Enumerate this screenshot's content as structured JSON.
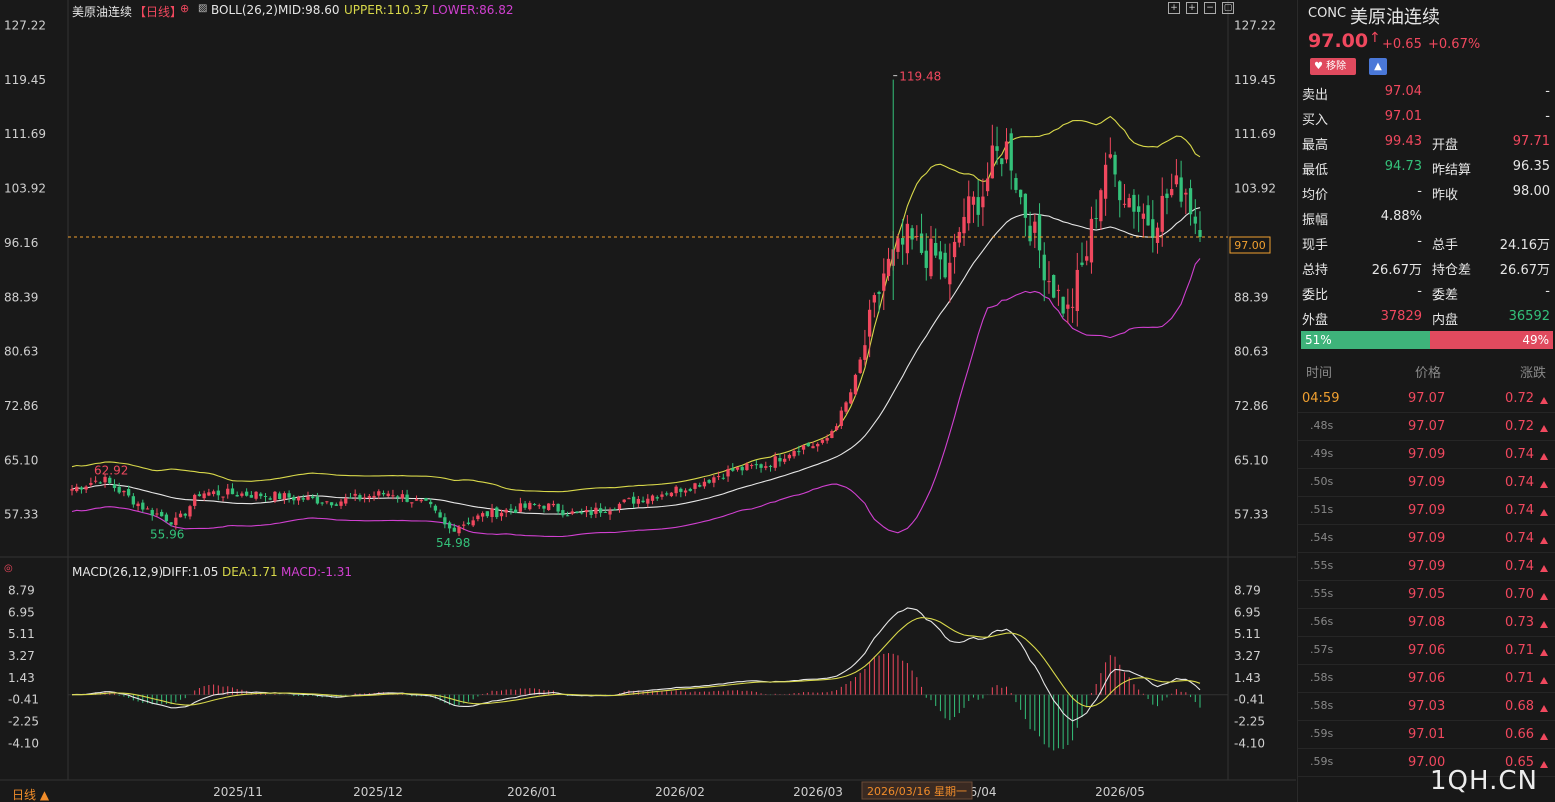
{
  "header": {
    "symbol_name": "美原油连续",
    "period": "【日线】",
    "boll_label": "BOLL(26,2)",
    "mid": "MID:98.60",
    "upper": "UPPER:110.37",
    "lower": "LOWER:86.82",
    "macd_label": "MACD(26,12,9)",
    "diff": "DIFF:1.05",
    "dea": "DEA:1.71",
    "macd": "MACD:-1.31"
  },
  "price_axis": [
    "127.22",
    "119.45",
    "111.69",
    "103.92",
    "96.16",
    "88.39",
    "80.63",
    "72.86",
    "65.10",
    "57.33"
  ],
  "macd_axis": [
    "8.79",
    "6.95",
    "5.11",
    "3.27",
    "1.43",
    "-0.41",
    "-2.25",
    "-4.10"
  ],
  "date_axis": [
    "2025/11",
    "2025/12",
    "2026/01",
    "2026/02",
    "2026/03",
    "6/04",
    "2026/05"
  ],
  "crosshair_date": "2026/03/16 星期一",
  "current_price_label": "97.00",
  "annotations": {
    "high": "119.48",
    "left_high": "62.92",
    "low1": "55.96",
    "low2": "54.98"
  },
  "bottom_period": "日线 ▲",
  "watermark": "1QH.CN",
  "colors": {
    "up": "#f0485e",
    "down": "#34c17a",
    "boll_upper": "#d8d84a",
    "boll_mid": "#e6e6e6",
    "boll_lower": "#d040d0",
    "dea": "#d8d84a"
  },
  "chart_data": {
    "type": "candlestick",
    "title": "美原油连续",
    "ylim": [
      53,
      128
    ],
    "key_values": {
      "high": 119.48,
      "low": 54.98,
      "last": 97.0
    },
    "boll": {
      "mid": 98.6,
      "upper": 110.37,
      "lower": 86.82
    },
    "macd": {
      "diff": 1.05,
      "dea": 1.71,
      "macd": -1.31,
      "ylim": [
        -5.5,
        9.5
      ]
    }
  },
  "quote": {
    "code": "CONC",
    "name": "美原油连续",
    "price": "97.00",
    "change": "+0.65",
    "change_pct": "+0.67%",
    "remove_btn": "移除",
    "rows": [
      {
        "l1": "卖出",
        "v1": "97.04",
        "c1": "red",
        "l2": "",
        "v2": "-",
        "c2": "white"
      },
      {
        "l1": "买入",
        "v1": "97.01",
        "c1": "red",
        "l2": "",
        "v2": "-",
        "c2": "white"
      },
      {
        "l1": "最高",
        "v1": "99.43",
        "c1": "red",
        "l2": "开盘",
        "v2": "97.71",
        "c2": "red"
      },
      {
        "l1": "最低",
        "v1": "94.73",
        "c1": "green",
        "l2": "昨结算",
        "v2": "96.35",
        "c2": "white"
      },
      {
        "l1": "均价",
        "v1": "-",
        "c1": "white",
        "l2": "昨收",
        "v2": "98.00",
        "c2": "white"
      },
      {
        "l1": "振幅",
        "v1": "4.88%",
        "c1": "white",
        "l2": "",
        "v2": "",
        "c2": "white"
      },
      {
        "l1": "现手",
        "v1": "-",
        "c1": "white",
        "l2": "总手",
        "v2": "24.16万",
        "c2": "white"
      },
      {
        "l1": "总持",
        "v1": "26.67万",
        "c1": "white",
        "l2": "持仓差",
        "v2": "26.67万",
        "c2": "white"
      },
      {
        "l1": "委比",
        "v1": "-",
        "c1": "white",
        "l2": "委差",
        "v2": "-",
        "c2": "white"
      },
      {
        "l1": "外盘",
        "v1": "37829",
        "c1": "red",
        "l2": "内盘",
        "v2": "36592",
        "c2": "green"
      }
    ],
    "ratio_left": "51%",
    "ratio_right": "49%",
    "ratio_value": 0.51,
    "tick_headers": {
      "time": "时间",
      "price": "价格",
      "change": "涨跌"
    },
    "ticks": [
      {
        "t": "04:59",
        "p": "97.07",
        "c": "0.72"
      },
      {
        "t": ".48s",
        "p": "97.07",
        "c": "0.72"
      },
      {
        "t": ".49s",
        "p": "97.09",
        "c": "0.74"
      },
      {
        "t": ".50s",
        "p": "97.09",
        "c": "0.74"
      },
      {
        "t": ".51s",
        "p": "97.09",
        "c": "0.74"
      },
      {
        "t": ".54s",
        "p": "97.09",
        "c": "0.74"
      },
      {
        "t": ".55s",
        "p": "97.09",
        "c": "0.74"
      },
      {
        "t": ".55s",
        "p": "97.05",
        "c": "0.70"
      },
      {
        "t": ".56s",
        "p": "97.08",
        "c": "0.73"
      },
      {
        "t": ".57s",
        "p": "97.06",
        "c": "0.71"
      },
      {
        "t": ".58s",
        "p": "97.06",
        "c": "0.71"
      },
      {
        "t": ".58s",
        "p": "97.03",
        "c": "0.68"
      },
      {
        "t": ".59s",
        "p": "97.01",
        "c": "0.66"
      },
      {
        "t": ".59s",
        "p": "97.00",
        "c": "0.65"
      }
    ]
  }
}
